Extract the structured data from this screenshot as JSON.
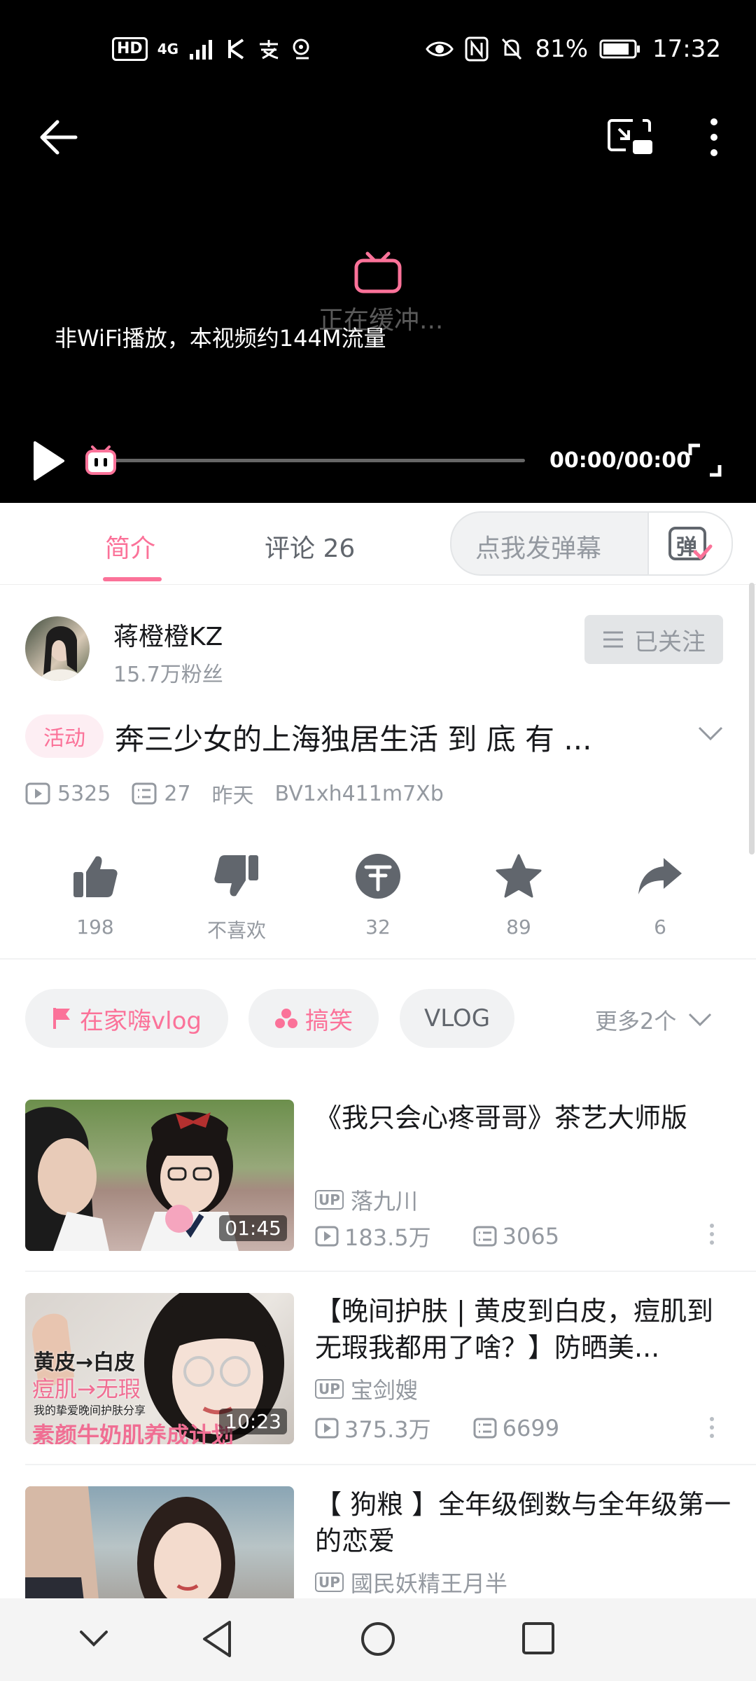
{
  "status_bar": {
    "left_hd": "HD",
    "left_net": "4G",
    "battery": "81%",
    "time": "17:32"
  },
  "player": {
    "buffer_text": "正在缓冲...",
    "wifi_notice": "非WiFi播放，本视频约144M流量",
    "time": "00:00/00:00",
    "accent": "#fb7299"
  },
  "tabs": {
    "intro": "简介",
    "comments": "评论 26",
    "danmu_placeholder": "点我发弹幕",
    "danmu_button": "弹"
  },
  "uploader": {
    "name": "蒋橙橙KZ",
    "fans": "15.7万粉丝",
    "follow_label": "已关注"
  },
  "video": {
    "activity_tag": "活动",
    "title": "奔三少女的上海独居生活 到 底 有 ...",
    "views": "5325",
    "danmaku": "27",
    "date": "昨天",
    "bvid": "BV1xh411m7Xb"
  },
  "actions": {
    "like": "198",
    "dislike": "不喜欢",
    "coin": "32",
    "favorite": "89",
    "share": "6"
  },
  "tags": {
    "items": [
      "在家嗨vlog",
      "搞笑",
      "VLOG"
    ],
    "more": "更多2个"
  },
  "recommendations": [
    {
      "title": "《我只会心疼哥哥》茶艺大师版",
      "up_badge": "UP",
      "up": "落九川",
      "views": "183.5万",
      "danmaku": "3065",
      "duration": "01:45"
    },
    {
      "title": "【晚间护肤 | 黄皮到白皮，痘肌到无瑕我都用了啥？】防晒美...",
      "up_badge": "UP",
      "up": "宝剑嫂",
      "views": "375.3万",
      "danmaku": "6699",
      "duration": "10:23",
      "thumb_text_1": "黄皮→白皮",
      "thumb_text_2": "痘肌→无瑕",
      "thumb_text_3": "我的挚爱晚间护肤分享",
      "thumb_text_4": "素颜牛奶肌养成计划"
    },
    {
      "title": "【 狗粮 】全年级倒数与全年级第一的恋爱",
      "up_badge": "UP",
      "up": "國民妖精王月半"
    }
  ]
}
